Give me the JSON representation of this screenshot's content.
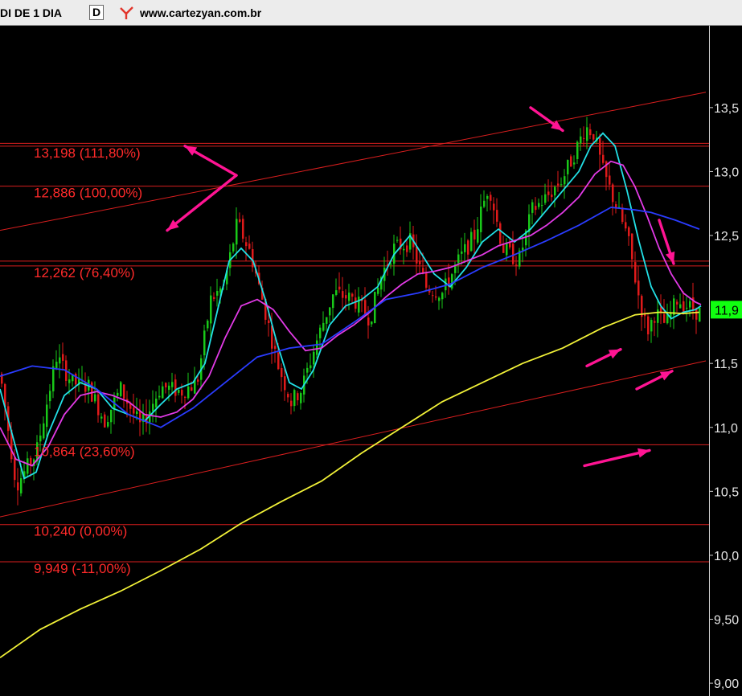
{
  "header": {
    "symbol_label": "DI DE 1 DIA",
    "period": "D",
    "site": "www.cartezyan.com.br",
    "logo_icon": "cartezyan-logo-icon"
  },
  "colors": {
    "background": "#000000",
    "candle_up": "#19c819",
    "candle_down": "#e01a1a",
    "fib_line": "#d81e1e",
    "fib_label": "#ff2a2a",
    "arrow": "#ff1493",
    "ma_fast": "#22e0e6",
    "ma_mid": "#e23ae6",
    "ma_slow": "#2a3cff",
    "ma_long": "#f2f238",
    "price_badge": "#10ff10"
  },
  "chart_data": {
    "type": "candlestick",
    "y_axis": {
      "ticks": [
        "13,5",
        "13,0",
        "12,5",
        "11,5",
        "11,0",
        "10,5",
        "10,0",
        "9,50",
        "9,00"
      ],
      "tick_values": [
        13.5,
        13.0,
        12.5,
        11.5,
        11.0,
        10.5,
        10.0,
        9.5,
        9.0
      ],
      "range": [
        8.9,
        14.14
      ]
    },
    "last_price_label": "11,9",
    "last_price_value": 11.92,
    "fibonacci_levels": [
      {
        "value": 13.198,
        "label": "13,198 (111,80%)"
      },
      {
        "value": 12.886,
        "label": "12,886 (100,00%)"
      },
      {
        "value": 12.262,
        "label": "12,262 (76,40%)"
      },
      {
        "value": 10.864,
        "label": "10,864 (23,60%)"
      },
      {
        "value": 10.24,
        "label": "10,240 (0,00%)"
      },
      {
        "value": 9.949,
        "label": "9,949 (-11,00%)"
      }
    ],
    "extra_levels": [
      13.22,
      12.3
    ],
    "trendlines": [
      {
        "x": [
          0,
          878
        ],
        "y": [
          12.54,
          13.62
        ]
      },
      {
        "x": [
          0,
          878
        ],
        "y": [
          10.3,
          11.52
        ]
      }
    ],
    "close_path": {
      "x": [
        0,
        20,
        45,
        70,
        90,
        110,
        130,
        150,
        175,
        200,
        225,
        245,
        262,
        278,
        295,
        312,
        328,
        345,
        362,
        375,
        395,
        415,
        440,
        460,
        475,
        490,
        510,
        530,
        550,
        570,
        590,
        608,
        625,
        645,
        662,
        680,
        700,
        715,
        728,
        738,
        750,
        762,
        780,
        795,
        805,
        815,
        828,
        842,
        855,
        868
      ],
      "y": [
        11.42,
        10.55,
        10.8,
        11.55,
        11.35,
        11.32,
        11.05,
        11.3,
        11.0,
        11.32,
        11.28,
        11.35,
        12.0,
        12.1,
        12.6,
        12.35,
        11.95,
        11.5,
        11.2,
        11.3,
        11.7,
        12.05,
        12.0,
        11.85,
        12.2,
        12.4,
        12.45,
        12.1,
        12.05,
        12.3,
        12.5,
        12.9,
        12.4,
        12.3,
        12.7,
        12.8,
        12.95,
        13.15,
        13.35,
        13.3,
        13.0,
        12.8,
        12.5,
        12.0,
        11.75,
        11.9,
        11.8,
        12.0,
        11.95,
        11.9
      ]
    },
    "moving_averages": [
      {
        "key": "ma_fast",
        "x": [
          0,
          15,
          30,
          45,
          60,
          80,
          100,
          120,
          140,
          160,
          180,
          200,
          220,
          240,
          255,
          270,
          285,
          300,
          315,
          330,
          345,
          360,
          375,
          390,
          410,
          430,
          450,
          470,
          490,
          510,
          525,
          540,
          560,
          580,
          600,
          620,
          640,
          660,
          680,
          700,
          720,
          735,
          750,
          765,
          780,
          795,
          810,
          822,
          835,
          850,
          865,
          872
        ],
        "y": [
          11.3,
          10.95,
          10.6,
          10.65,
          10.95,
          11.25,
          11.35,
          11.3,
          11.15,
          11.1,
          11.05,
          11.18,
          11.3,
          11.35,
          11.5,
          11.9,
          12.3,
          12.4,
          12.3,
          12.0,
          11.65,
          11.35,
          11.3,
          11.45,
          11.8,
          11.95,
          12.0,
          12.1,
          12.35,
          12.5,
          12.35,
          12.2,
          12.1,
          12.25,
          12.45,
          12.55,
          12.45,
          12.55,
          12.7,
          12.85,
          13.0,
          13.2,
          13.3,
          13.2,
          12.85,
          12.45,
          12.1,
          11.95,
          11.85,
          11.9,
          11.92,
          11.95
        ]
      },
      {
        "key": "ma_mid",
        "x": [
          0,
          20,
          40,
          60,
          80,
          100,
          120,
          140,
          160,
          180,
          200,
          220,
          240,
          260,
          280,
          300,
          320,
          340,
          360,
          380,
          400,
          420,
          440,
          460,
          480,
          500,
          520,
          540,
          560,
          580,
          600,
          620,
          640,
          660,
          680,
          700,
          720,
          740,
          760,
          775,
          790,
          805,
          820,
          835,
          850,
          865,
          872
        ],
        "y": [
          11.0,
          10.75,
          10.7,
          10.85,
          11.1,
          11.25,
          11.28,
          11.25,
          11.2,
          11.1,
          11.08,
          11.12,
          11.22,
          11.4,
          11.7,
          11.95,
          12.0,
          11.92,
          11.75,
          11.6,
          11.62,
          11.72,
          11.8,
          11.9,
          12.02,
          12.12,
          12.2,
          12.22,
          12.25,
          12.3,
          12.35,
          12.42,
          12.46,
          12.5,
          12.58,
          12.68,
          12.8,
          12.98,
          13.08,
          13.05,
          12.88,
          12.65,
          12.4,
          12.2,
          12.05,
          11.98,
          11.96
        ]
      },
      {
        "key": "ma_slow",
        "x": [
          0,
          40,
          80,
          120,
          160,
          200,
          240,
          280,
          320,
          360,
          400,
          440,
          480,
          520,
          560,
          600,
          640,
          680,
          720,
          760,
          790,
          810,
          840,
          870
        ],
        "y": [
          11.4,
          11.48,
          11.45,
          11.3,
          11.1,
          11.0,
          11.15,
          11.35,
          11.55,
          11.62,
          11.65,
          11.82,
          12.0,
          12.05,
          12.12,
          12.25,
          12.35,
          12.46,
          12.58,
          12.72,
          12.7,
          12.68,
          12.62,
          12.55
        ]
      },
      {
        "key": "ma_long",
        "x": [
          0,
          50,
          100,
          150,
          200,
          250,
          300,
          350,
          400,
          450,
          500,
          550,
          600,
          650,
          700,
          750,
          790,
          820,
          850,
          870
        ],
        "y": [
          9.2,
          9.42,
          9.58,
          9.72,
          9.88,
          10.05,
          10.25,
          10.42,
          10.58,
          10.8,
          11.0,
          11.2,
          11.35,
          11.5,
          11.62,
          11.78,
          11.88,
          11.9,
          11.89,
          11.9
        ]
      }
    ],
    "annotation_arrows": [
      {
        "from": [
          294,
          12.97
        ],
        "to": [
          230,
          13.2
        ]
      },
      {
        "from": [
          294,
          12.97
        ],
        "to": [
          208,
          12.54
        ]
      },
      {
        "from": [
          660,
          13.5
        ],
        "to": [
          700,
          13.32
        ]
      },
      {
        "from": [
          820,
          12.62
        ],
        "to": [
          838,
          12.28
        ]
      },
      {
        "from": [
          730,
          11.48
        ],
        "to": [
          772,
          11.61
        ]
      },
      {
        "from": [
          792,
          11.3
        ],
        "to": [
          836,
          11.44
        ]
      },
      {
        "from": [
          727,
          10.7
        ],
        "to": [
          808,
          10.82
        ]
      }
    ]
  }
}
